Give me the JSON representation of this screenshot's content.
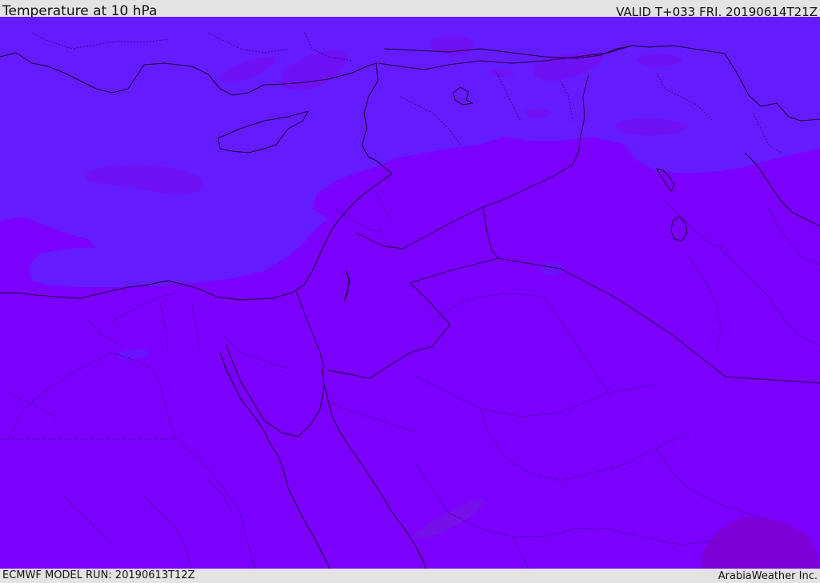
{
  "header": {
    "title": "Temperature at 10 hPa",
    "valid_time": "VALID T+033 FRI. 20190614T21Z"
  },
  "footer": {
    "model_run": "ECMWF MODEL RUN: 20190613T12Z",
    "credit": "ArabiaWeather Inc."
  },
  "map": {
    "colors": {
      "field_cold": "#651bff",
      "field_mid": "#7b00fe",
      "field_warm_patch": "#7610e8",
      "field_warmest_patch": "#7d00d8",
      "coastline": "#1a0030",
      "border": "#20003a"
    }
  }
}
